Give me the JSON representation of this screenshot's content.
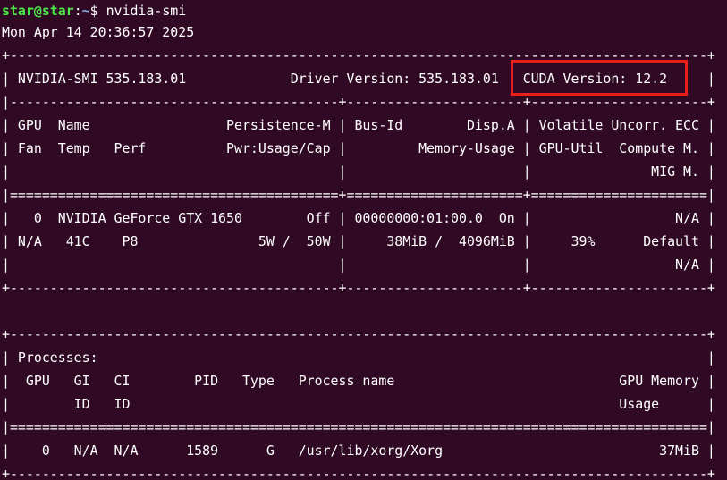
{
  "window": {
    "title": "star@star: ~",
    "accent_color": "#e8201c"
  },
  "prompt": {
    "user_host": "star@star",
    "separator": ":",
    "path": "~",
    "symbol": "$ ",
    "command": "nvidia-smi"
  },
  "output": {
    "timestamp": "Mon Apr 14 20:36:57 2025",
    "lines": [
      "+---------------------------------------------------------------------------------------+",
      "| NVIDIA-SMI 535.183.01             Driver Version: 535.183.01   CUDA Version: 12.2     |",
      "|-----------------------------------------+----------------------+----------------------+",
      "| GPU  Name                 Persistence-M | Bus-Id        Disp.A | Volatile Uncorr. ECC |",
      "| Fan  Temp   Perf          Pwr:Usage/Cap |         Memory-Usage | GPU-Util  Compute M. |",
      "|                                         |                      |               MIG M. |",
      "|=========================================+======================+======================|",
      "|   0  NVIDIA GeForce GTX 1650        Off | 00000000:01:00.0  On |                  N/A |",
      "| N/A   41C    P8               5W /  50W |     38MiB /  4096MiB |     39%      Default |",
      "|                                         |                      |                  N/A |",
      "+-----------------------------------------+----------------------+----------------------+",
      "",
      "+---------------------------------------------------------------------------------------+",
      "| Processes:                                                                            |",
      "|  GPU   GI   CI        PID   Type   Process name                            GPU Memory |",
      "|        ID   ID                                                             Usage      |",
      "|=======================================================================================|",
      "|    0   N/A  N/A      1589      G   /usr/lib/xorg/Xorg                           37MiB |",
      "+---------------------------------------------------------------------------------------+"
    ]
  },
  "highlight": {
    "label": "CUDA Version: 12.2"
  }
}
